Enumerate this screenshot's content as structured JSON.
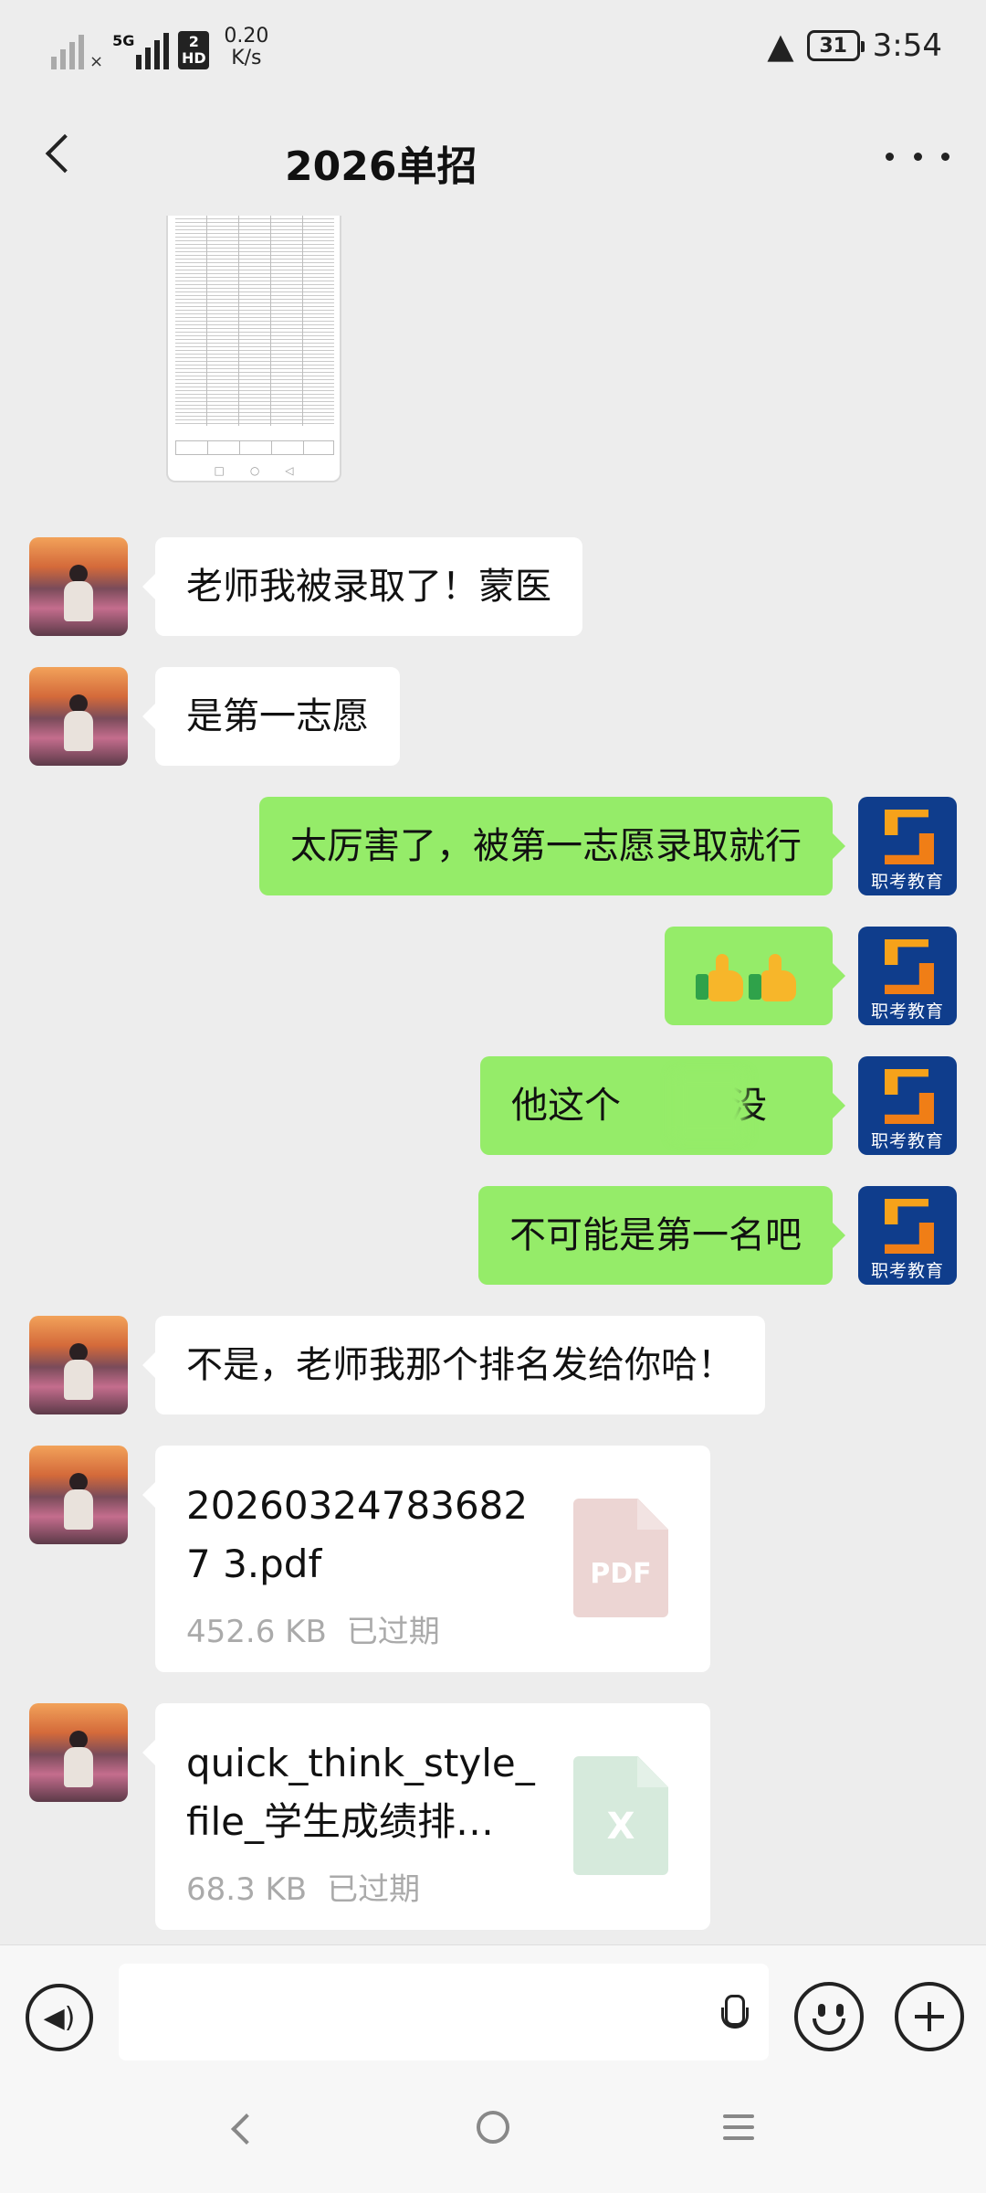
{
  "status_bar": {
    "network_tag": "5G",
    "sim_slot": "2",
    "hd_label": "HD",
    "speed_value": "0.20",
    "speed_unit": "K/s",
    "battery": "31",
    "time": "3:54"
  },
  "header": {
    "title": "2026单招"
  },
  "messages": [
    {
      "side": "in",
      "text": "老师我被录取了！蒙医"
    },
    {
      "side": "in",
      "text": "是第一志愿"
    },
    {
      "side": "out",
      "text": "太厉害了，被第一志愿录取就行"
    },
    {
      "side": "out",
      "type": "emoji",
      "emoji": "thumbs-up x2"
    },
    {
      "side": "out",
      "text": "他这个有没"
    },
    {
      "side": "out",
      "text": "不可能是第一名吧"
    },
    {
      "side": "in",
      "text": "不是，老师我那个排名发给你哈！"
    }
  ],
  "files": [
    {
      "name": "202603247836827 3.pdf",
      "size": "452.6 KB",
      "status": "已过期",
      "icon_label": "PDF",
      "icon_color": "#ecd5d3"
    },
    {
      "name": "quick_think_style_file_学生成绩排…",
      "size": "68.3 KB",
      "status": "已过期",
      "icon_label": "X",
      "icon_color": "#d6eadc"
    }
  ],
  "sender_logo": {
    "text": "职考教育"
  },
  "colors": {
    "outgoing_bubble": "#95ec69",
    "incoming_bubble": "#ffffff",
    "background": "#ededed"
  }
}
